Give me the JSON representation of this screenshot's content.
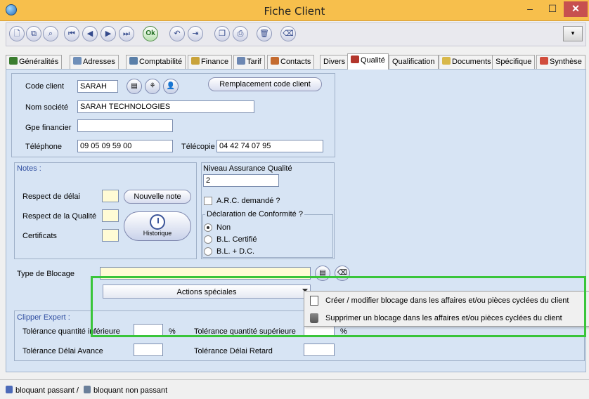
{
  "window": {
    "title": "Fiche Client",
    "min_glyph": "–",
    "max_glyph": "☐",
    "close_glyph": "✕"
  },
  "toolbar": {
    "buttons": [
      {
        "name": "new-icon",
        "glyph": "🗋"
      },
      {
        "name": "copy-icon",
        "glyph": "⧉"
      },
      {
        "name": "search-icon",
        "glyph": "⌕"
      },
      {
        "name": "first-icon",
        "glyph": "⏮"
      },
      {
        "name": "previous-icon",
        "glyph": "◀"
      },
      {
        "name": "next-icon",
        "glyph": "▶"
      },
      {
        "name": "last-icon",
        "glyph": "⏭"
      },
      {
        "name": "ok-icon",
        "glyph": "Ok"
      },
      {
        "name": "undo-icon",
        "glyph": "↶"
      },
      {
        "name": "exit-icon",
        "glyph": "⇥"
      },
      {
        "name": "duplicate-icon",
        "glyph": "❐"
      },
      {
        "name": "print-icon",
        "glyph": "⎙"
      },
      {
        "name": "delete-icon",
        "glyph": "🗑"
      },
      {
        "name": "eraser-icon",
        "glyph": "⌫"
      }
    ],
    "dropdown_glyph": "▾"
  },
  "tabs": [
    {
      "label": "Généralités",
      "icon_color": "#3a7d2f"
    },
    {
      "label": "Adresses",
      "icon_color": "#6f8fb9"
    },
    {
      "label": "Comptabilité",
      "icon_color": "#5a7fa8"
    },
    {
      "label": "Finance",
      "icon_color": "#c9a33a"
    },
    {
      "label": "Tarif",
      "icon_color": "#6d88b3"
    },
    {
      "label": "Contacts",
      "icon_color": "#c46b2f"
    },
    {
      "label": "Divers",
      "icon_color": ""
    },
    {
      "label": "Qualité",
      "icon_color": "#b3362c"
    },
    {
      "label": "Qualification",
      "icon_color": ""
    },
    {
      "label": "Documents",
      "icon_color": "#d8b84a"
    },
    {
      "label": "Spécifique",
      "icon_color": ""
    },
    {
      "label": "Synthèse",
      "icon_color": "#d14d3d"
    }
  ],
  "client": {
    "code_label": "Code client",
    "code_value": "SARAH",
    "replace_code_button": "Remplacement code client",
    "nom_label": "Nom société",
    "nom_value": "SARAH TECHNOLOGIES",
    "gpe_label": "Gpe financier",
    "gpe_value": "",
    "tel_label": "Téléphone",
    "tel_value": "09 05 09 59 00",
    "fax_label": "Télécopie",
    "fax_value": "04 42 74 07 95"
  },
  "notes": {
    "title": "Notes :",
    "delai_label": "Respect de délai",
    "qualite_label": "Respect de la Qualité",
    "certificats_label": "Certificats",
    "new_note_button": "Nouvelle note",
    "history_button": "Historique"
  },
  "qualite": {
    "niveau_label": "Niveau Assurance Qualité",
    "niveau_value": "2",
    "arc_label": "A.R.C. demandé ?",
    "conformite_title": "Déclaration de Conformité ?",
    "options": [
      "Non",
      "B.L. Certifié",
      "B.L. + D.C."
    ],
    "selected": "Non"
  },
  "blocage": {
    "label": "Type de Blocage",
    "value": "",
    "actions_label": "Actions spéciales"
  },
  "menu": {
    "items": [
      "Créer / modifier blocage dans les affaires et/ou pièces cyclées du client",
      "Supprimer un blocage dans les affaires et/ou pièces cyclées du client"
    ]
  },
  "clipper": {
    "title": "Clipper Expert :",
    "tol_inf_label": "Tolérance quantité inférieure",
    "tol_sup_label": "Tolérance quantité supérieure",
    "percent": "%",
    "delai_avance_label": "Tolérance Délai Avance",
    "delai_retard_label": "Tolérance Délai Retard"
  },
  "status": {
    "text1": "bloquant passant /",
    "text2": "bloquant non passant"
  },
  "colors": {
    "titlebar": "#f7bf4c",
    "panel": "#d7e4f4",
    "highlight": "#39c53a",
    "close": "#c7504f"
  }
}
